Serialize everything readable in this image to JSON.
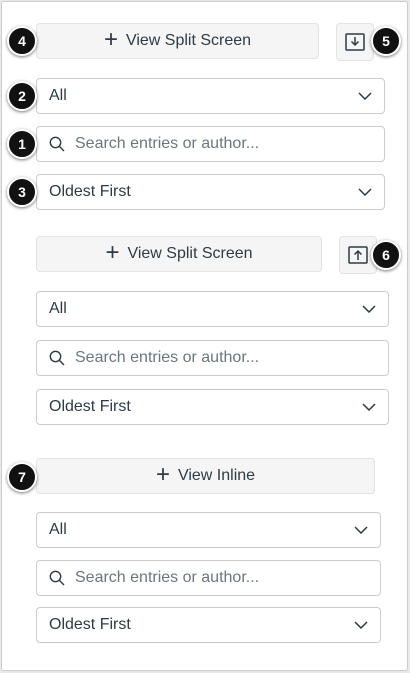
{
  "colors": {
    "text": "#2d3b45",
    "placeholder": "#6b7780",
    "button_bg": "#f5f5f5",
    "border": "#c7cdd1",
    "badge_bg": "#111111"
  },
  "badges": [
    "4",
    "5",
    "2",
    "1",
    "3",
    "6",
    "7"
  ],
  "section1": {
    "split_button_label": "View Split Screen",
    "action_icon": "download-icon",
    "filter_value": "All",
    "search_placeholder": "Search entries or author...",
    "sort_value": "Oldest First"
  },
  "section2": {
    "split_button_label": "View Split Screen",
    "action_icon": "upload-icon",
    "filter_value": "All",
    "search_placeholder": "Search entries or author...",
    "sort_value": "Oldest First"
  },
  "section3": {
    "inline_button_label": "View Inline",
    "filter_value": "All",
    "search_placeholder": "Search entries or author...",
    "sort_value": "Oldest First"
  }
}
